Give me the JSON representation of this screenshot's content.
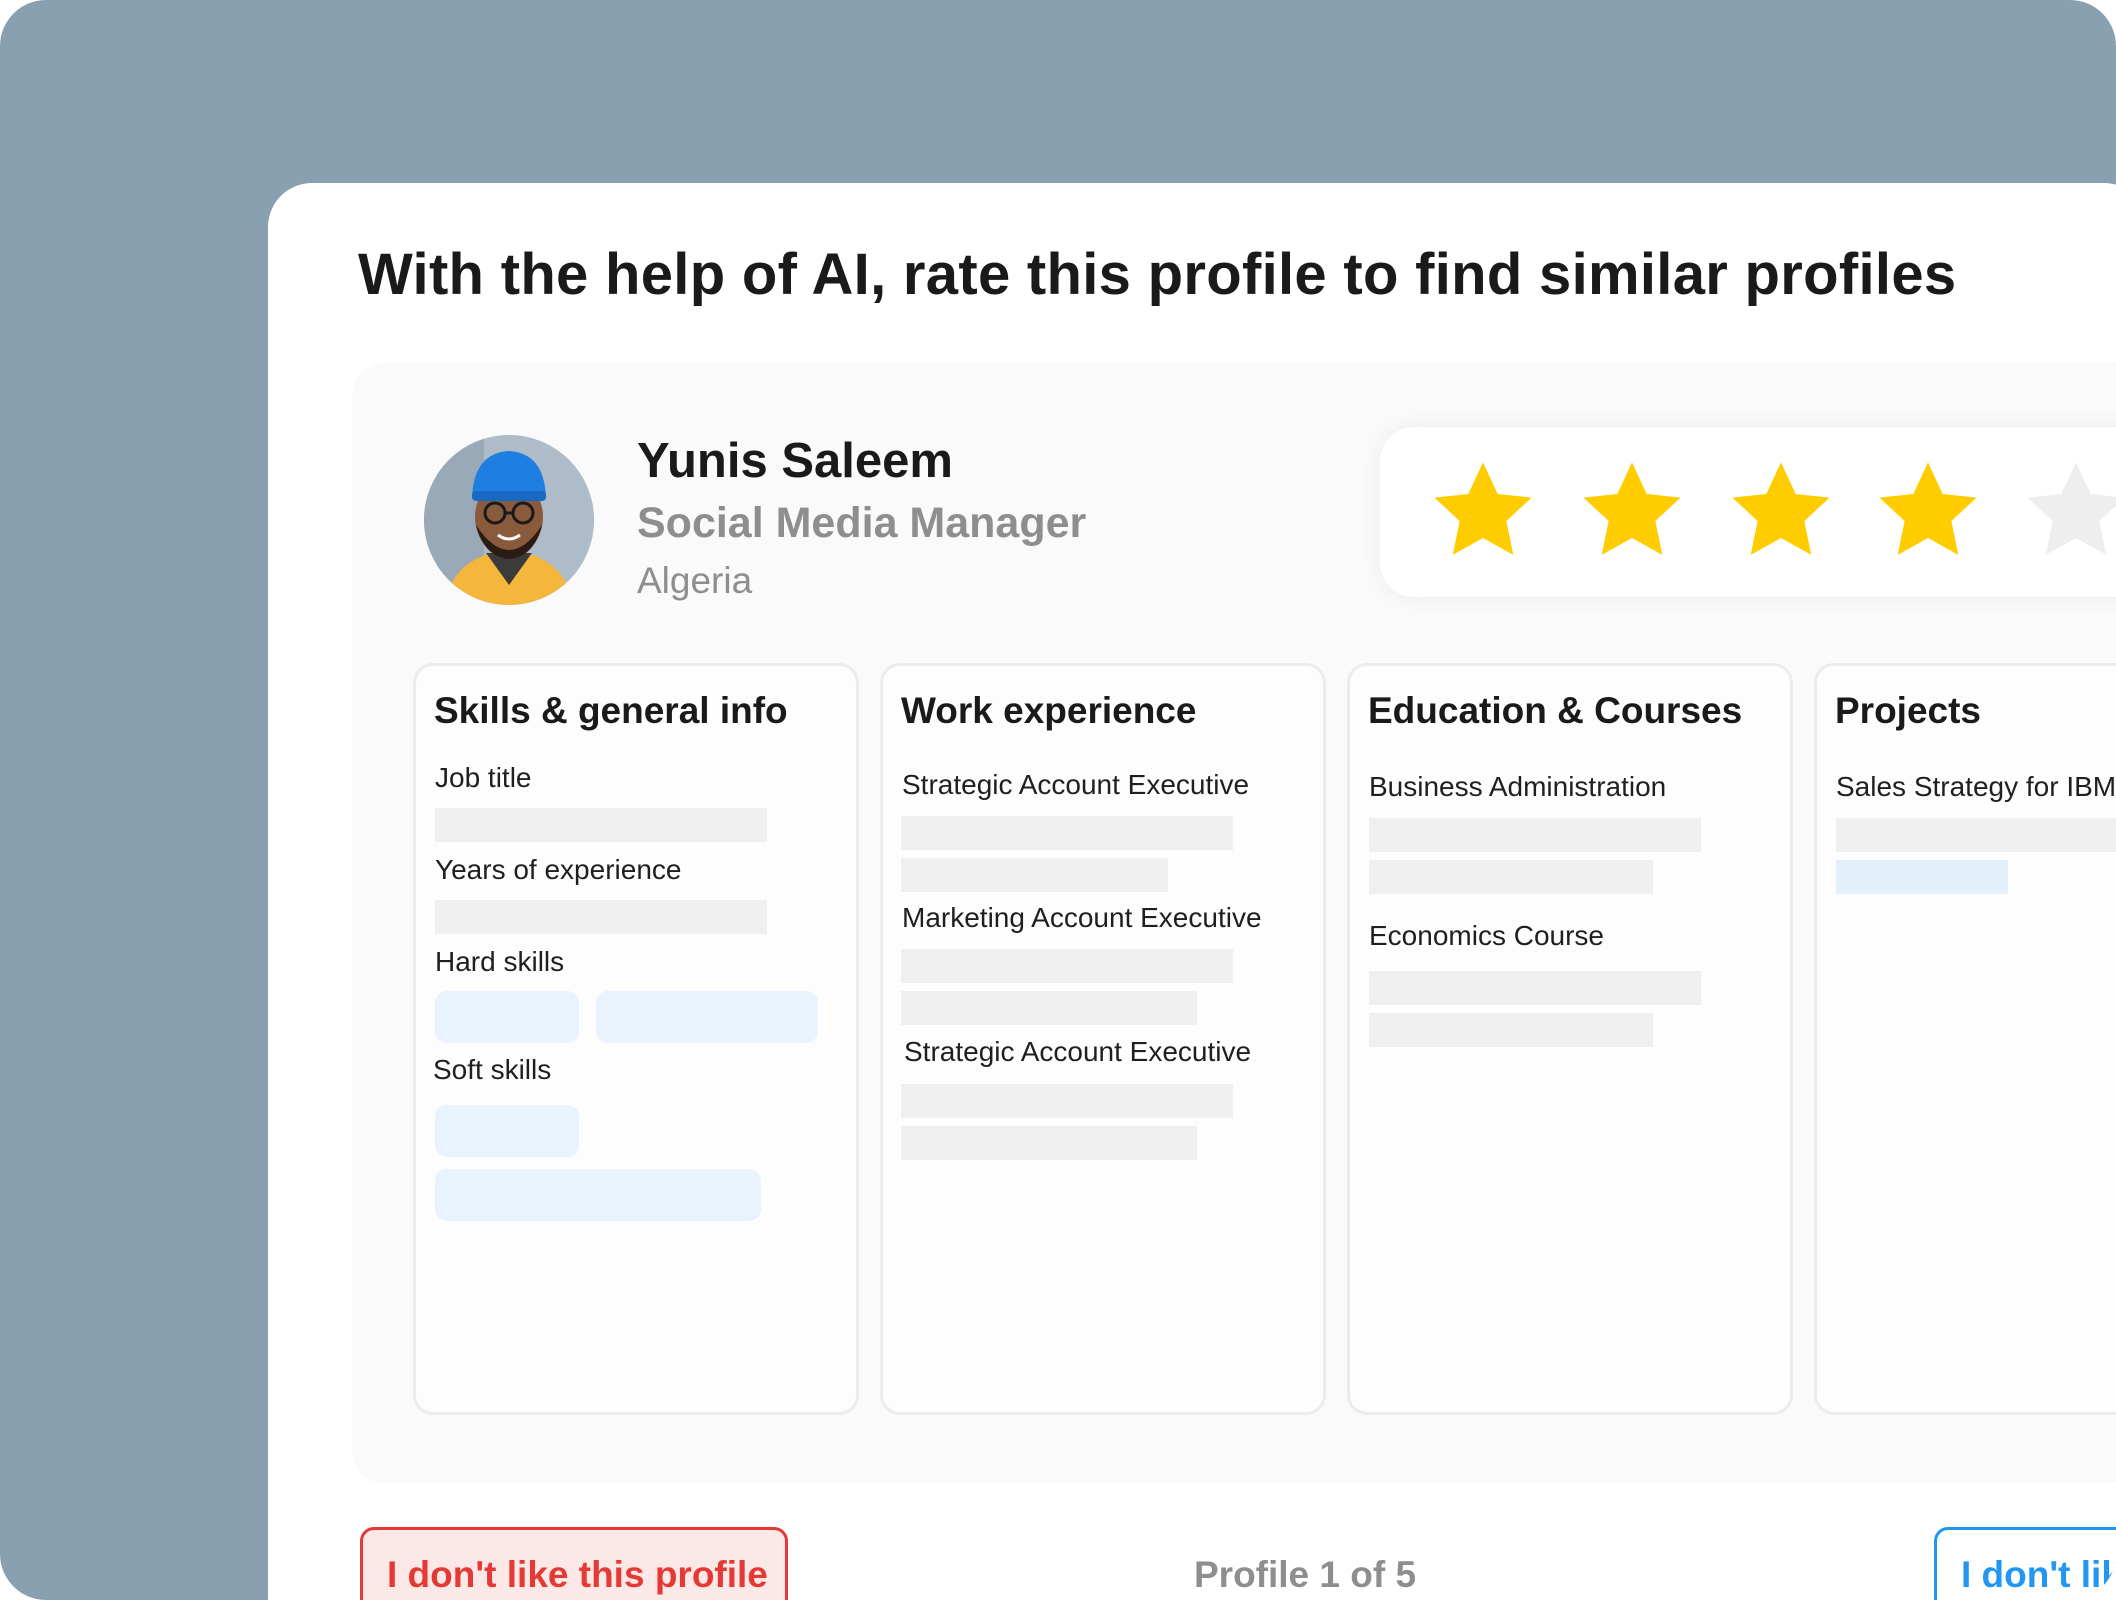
{
  "headline": "With the help of AI, rate this profile to find similar profiles",
  "profile": {
    "name": "Yunis Saleem",
    "role": "Social Media Manager",
    "country": "Algeria"
  },
  "rating": {
    "value": 4,
    "max": 5,
    "filled_color": "#ffcc00",
    "empty_color": "#eeeeee"
  },
  "cards": {
    "skills": {
      "title": "Skills & general info",
      "job_title_label": "Job title",
      "years_label": "Years of experience",
      "hard_skills_label": "Hard skills",
      "soft_skills_label": "Soft skills"
    },
    "work": {
      "title": "Work experience",
      "items": [
        "Strategic Account Executive",
        "Marketing Account Executive",
        "Strategic Account Executive"
      ]
    },
    "education": {
      "title": "Education & Courses",
      "items": [
        "Business Administration",
        "Economics Course"
      ]
    },
    "projects": {
      "title": "Projects",
      "items": [
        "Sales Strategy for IBM"
      ]
    }
  },
  "footer": {
    "dislike_label": "I don't like this profile",
    "pager_label": "Profile 1 of 5",
    "dislike_label_2": "I don't like this profile"
  },
  "colors": {
    "backdrop": "#89a0b0",
    "danger": "#e53935",
    "primary": "#2196f3",
    "chip": "#e8f3fd"
  }
}
